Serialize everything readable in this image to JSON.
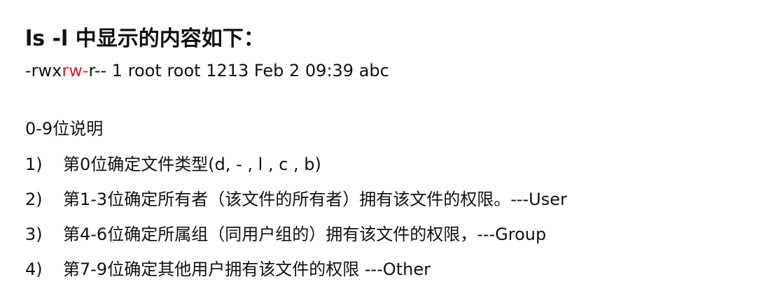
{
  "heading": "ls  -l 中显示的内容如下：",
  "ls_line": {
    "prefix": "-rwx",
    "highlight": "rw-",
    "suffix": "r-- 1 root root 1213 Feb 2 09:39 abc",
    "highlight_color": "#e02020"
  },
  "section_title": "0-9位说明",
  "items": [
    {
      "num": "1)",
      "text": "第0位确定文件类型(d, - , l , c , b)"
    },
    {
      "num": "2)",
      "text": "第1-3位确定所有者（该文件的所有者）拥有该文件的权限。---User"
    },
    {
      "num": "3)",
      "text": "第4-6位确定所属组（同用户组的）拥有该文件的权限，---Group"
    },
    {
      "num": "4)",
      "text": "第7-9位确定其他用户拥有该文件的权限 ---Other"
    }
  ]
}
